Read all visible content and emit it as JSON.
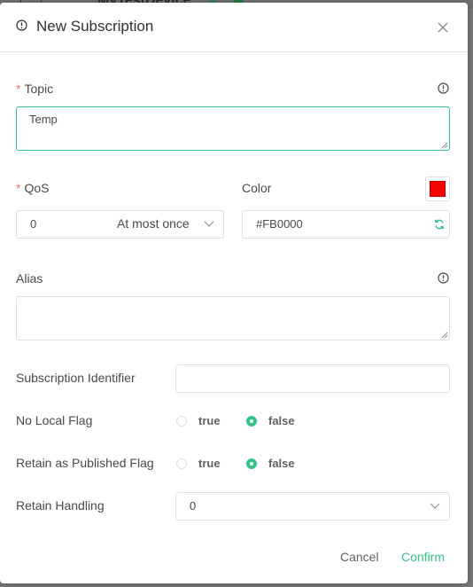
{
  "background": {
    "left_fragment": "│ − │",
    "title_fragment": "MyTestDevice"
  },
  "dialog": {
    "title": "New Subscription"
  },
  "topic": {
    "label": "Topic",
    "required_mark": "*",
    "value": "Temp"
  },
  "qos": {
    "label": "QoS",
    "required_mark": "*",
    "value": "0",
    "value_description": "At most once"
  },
  "color": {
    "label": "Color",
    "value": "#FB0000",
    "swatch": "#FB0000"
  },
  "alias": {
    "label": "Alias",
    "value": ""
  },
  "subscription_identifier": {
    "label": "Subscription Identifier",
    "value": ""
  },
  "no_local_flag": {
    "label": "No Local Flag",
    "options": [
      "true",
      "false"
    ],
    "selected": "false"
  },
  "retain_as_published_flag": {
    "label": "Retain as Published Flag",
    "options": [
      "true",
      "false"
    ],
    "selected": "false"
  },
  "retain_handling": {
    "label": "Retain Handling",
    "value": "0"
  },
  "footer": {
    "cancel_label": "Cancel",
    "confirm_label": "Confirm"
  },
  "colors": {
    "accent": "#34c388",
    "required": "#f56c6c"
  }
}
